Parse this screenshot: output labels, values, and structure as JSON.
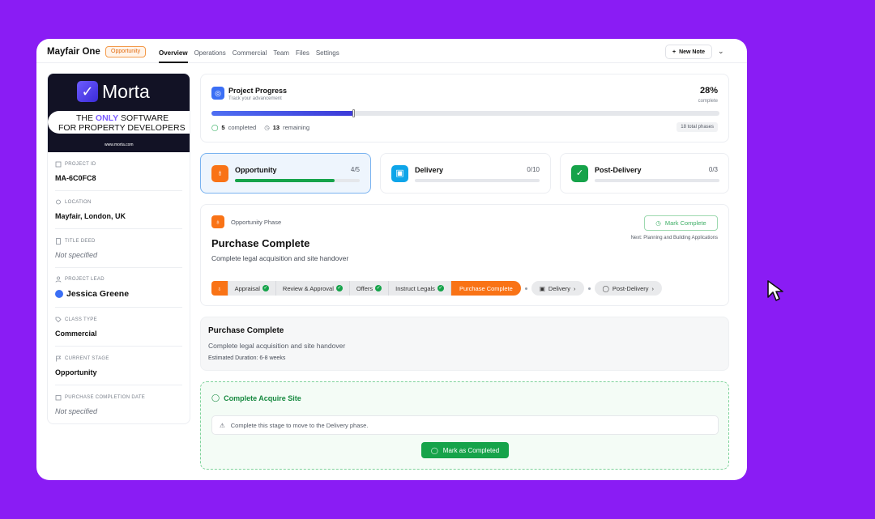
{
  "app": {
    "title": "Mayfair One",
    "status_badge": "Opportunity"
  },
  "tabs": [
    {
      "label": "Overview",
      "active": true
    },
    {
      "label": "Operations"
    },
    {
      "label": "Commercial"
    },
    {
      "label": "Team"
    },
    {
      "label": "Files"
    },
    {
      "label": "Settings"
    }
  ],
  "header": {
    "new_note_label": "New Note"
  },
  "banner": {
    "logo_text": "Morta",
    "line1_pre": "THE ",
    "line1_highlight": "ONLY",
    "line1_post": " SOFTWARE",
    "line2": "FOR PROPERTY DEVELOPERS",
    "url": "www.morta.com"
  },
  "sidebar": {
    "fields": [
      {
        "label": "PROJECT ID",
        "value": "MA-6C0FC8"
      },
      {
        "label": "LOCATION",
        "value": "Mayfair, London, UK"
      },
      {
        "label": "TITLE DEED",
        "value": "Not specified"
      },
      {
        "label": "PROJECT LEAD",
        "value": "Jessica Greene"
      },
      {
        "label": "CLASS TYPE",
        "value": "Commercial"
      },
      {
        "label": "CURRENT STAGE",
        "value": "Opportunity"
      },
      {
        "label": "PURCHASE COMPLETION DATE",
        "value": "Not specified"
      }
    ]
  },
  "progress": {
    "title": "Project Progress",
    "subtitle": "Track your advancement",
    "percent_label": "28%",
    "percent_value": 0.28,
    "percent_sub": "complete",
    "completed_count": "5",
    "completed_label": "completed",
    "remaining_count": "13",
    "remaining_label": "remaining",
    "total_label": "18 total phases"
  },
  "phases": [
    {
      "name": "Opportunity",
      "count": "4/5",
      "fraction": 0.8,
      "color": "#f97316",
      "icon": "lightbulb-icon"
    },
    {
      "name": "Delivery",
      "count": "0/10",
      "fraction": 0,
      "color": "#0ea5e9",
      "icon": "box-icon"
    },
    {
      "name": "Post-Delivery",
      "count": "0/3",
      "fraction": 0,
      "color": "#16a34a",
      "icon": "check-circle-icon"
    }
  ],
  "detail": {
    "phase_label": "Opportunity Phase",
    "title": "Purchase Complete",
    "description": "Complete legal acquisition and site handover",
    "mark_complete_label": "Mark Complete",
    "next_label": "Next: Planning and Building Applications",
    "steps": [
      "Appraisal",
      "Review & Approval",
      "Offers",
      "Instruct Legals"
    ],
    "current_step": "Purchase Complete",
    "next_phases": [
      "Delivery",
      "Post-Delivery"
    ]
  },
  "info": {
    "title": "Purchase Complete",
    "description": "Complete legal acquisition and site handover",
    "duration": "Estimated Duration: 6-8 weeks"
  },
  "complete": {
    "title": "Complete Acquire Site",
    "alert": "Complete this stage to move to the Delivery phase.",
    "button_label": "Mark as Completed"
  }
}
